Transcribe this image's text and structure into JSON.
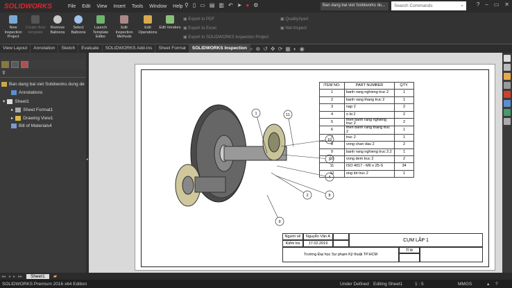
{
  "app": {
    "logo": "SOLIDWORKS",
    "menu": [
      "File",
      "Edit",
      "View",
      "Insert",
      "Tools",
      "Window",
      "Help"
    ],
    "doc_title": "Ban dang bai viet Solidworks du...",
    "search_placeholder": "Search Commands"
  },
  "ribbon": {
    "buttons": [
      {
        "label": "New Inspection Project",
        "enabled": true
      },
      {
        "label": "Create New template",
        "enabled": false
      },
      {
        "label": "Remove Balloons",
        "enabled": true
      },
      {
        "label": "Select Balloons",
        "enabled": true
      },
      {
        "label": "Launch Template Editor",
        "enabled": true
      },
      {
        "label": "Edit Inspection Methods",
        "enabled": true
      },
      {
        "label": "Edit Operations",
        "enabled": true
      },
      {
        "label": "Edit Vendors",
        "enabled": true
      }
    ],
    "exports": [
      "Export to PDF",
      "Export to Excel",
      "Export to SOLIDWORKS Inspection Project"
    ],
    "extras": [
      "QualityXpert",
      "Net-Inspect"
    ]
  },
  "tabs": [
    "View Layout",
    "Annotation",
    "Sketch",
    "Evaluate",
    "SOLIDWORKS Add-Ins",
    "Sheet Format",
    "SOLIDWORKS Inspection"
  ],
  "active_tab": "SOLIDWORKS Inspection",
  "tree": {
    "root": "Ban dang bai viet Solidworks dung de",
    "items": [
      "Annotations",
      "Sheet1",
      "Sheet Format1",
      "Drawing View1",
      "Bill of Materials4"
    ]
  },
  "bom": {
    "headers": [
      "ITEM NO.",
      "PART NUMBER",
      "QTY."
    ],
    "rows": [
      [
        "1",
        "banh rang nghieng truc 2",
        "1"
      ],
      [
        "2",
        "banh rang thang truc 2",
        "1"
      ],
      [
        "3",
        "nap 2",
        "2"
      ],
      [
        "4",
        "o bi 2",
        "2"
      ],
      [
        "5",
        "then banh rang nghieng truc 2",
        "2"
      ],
      [
        "6",
        "then banh rang thang truc 2",
        "1"
      ],
      [
        "7",
        "truc 2",
        "1"
      ],
      [
        "8",
        "vong chan dau 2",
        "2"
      ],
      [
        "9",
        "banh rang nghieng truc 2.2",
        "1"
      ],
      [
        "10",
        "vong dem truc 2",
        "2"
      ],
      [
        "11",
        "ISO 4017 - M6 x 25-S",
        "34"
      ],
      [
        "12",
        "ong lot truc 2",
        "1"
      ]
    ]
  },
  "balloons": [
    "1",
    "11",
    "10",
    "3",
    "4",
    "2",
    "8",
    "9"
  ],
  "title_block": {
    "drawn_by_label": "Người vẽ",
    "drawn_by": "Nguyễn Văn A",
    "checked_label": "Kiểm tra",
    "date": "17.02.2019",
    "title": "CỤM LẮP 1",
    "school": "Trường Đại học Sư phạm Kỹ thuật TP.HCM",
    "scale_label": "Tỉ lệ"
  },
  "sheet_tab": "Sheet1",
  "status": {
    "product": "SOLIDWORKS Premium 2016 x64 Edition",
    "defined": "Under Defined",
    "editing": "Editing Sheet1",
    "scale": "1 : 5",
    "units": "MMGS"
  },
  "colors": {
    "accent": "#e0262d",
    "dark": "#2b2b2b",
    "ribbon": "#333333"
  }
}
